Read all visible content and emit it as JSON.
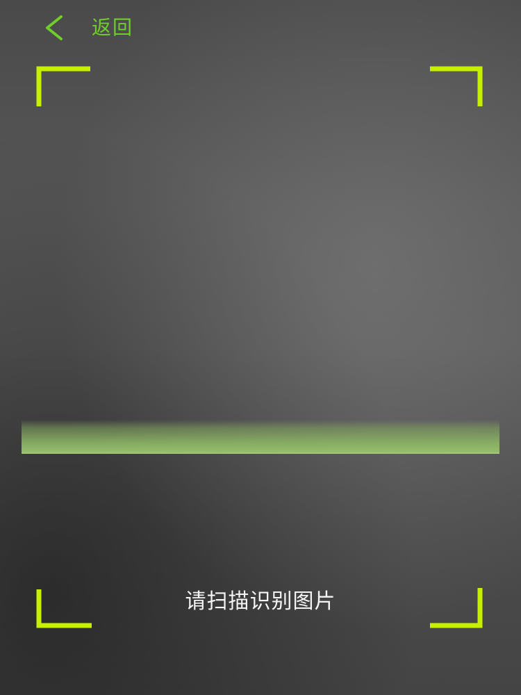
{
  "header": {
    "back_label": "返回",
    "back_icon": "chevron-left-icon"
  },
  "scanner": {
    "hint": "请扫描识别图片",
    "frame_color": "#c6f000",
    "scan_line_color": "#8fb86a"
  },
  "colors": {
    "accent": "#6fcf2a",
    "hint_text": "#f4f4f4"
  }
}
